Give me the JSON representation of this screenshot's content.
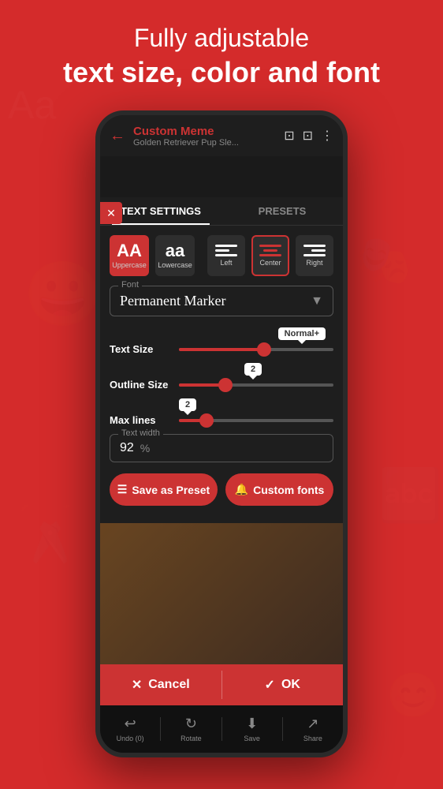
{
  "header": {
    "line1": "Fully adjustable",
    "line2": "text size, color and font"
  },
  "phone": {
    "topbar": {
      "back_icon": "←",
      "title": "Custom Meme",
      "subtitle": "Golden Retriever Pup Sle...",
      "icon1": "⊡",
      "icon2": "⊡",
      "icon3": "⋮"
    },
    "tabs": [
      {
        "label": "TEXT SETTINGS",
        "active": true
      },
      {
        "label": "PRESETS",
        "active": false
      }
    ],
    "format": {
      "uppercase": {
        "label": "AA",
        "sublabel": "Uppercase",
        "active": true
      },
      "lowercase": {
        "label": "aa",
        "sublabel": "Lowercase",
        "active": false
      },
      "align_left": {
        "sublabel": "Left",
        "active": false
      },
      "align_center": {
        "sublabel": "Center",
        "active": true
      },
      "align_right": {
        "sublabel": "Right",
        "active": false
      }
    },
    "font": {
      "label": "Font",
      "value": "Permanent Marker"
    },
    "text_size": {
      "label": "Text Size",
      "tooltip": "Normal+",
      "fill_pct": 55
    },
    "outline_size": {
      "label": "Outline Size",
      "tooltip": "2",
      "fill_pct": 30
    },
    "max_lines": {
      "label": "Max lines",
      "tooltip": "2",
      "fill_pct": 20
    },
    "text_width": {
      "label": "Text width",
      "value": "92",
      "unit": "%"
    },
    "buttons": {
      "save_preset": "Save as Preset",
      "custom_fonts": "Custom fonts"
    },
    "bottom_bar": {
      "cancel": "Cancel",
      "ok": "OK"
    },
    "toolbar": {
      "undo": "Undo (0)",
      "rotate": "Rotate",
      "save": "Save",
      "share": "Share"
    }
  }
}
